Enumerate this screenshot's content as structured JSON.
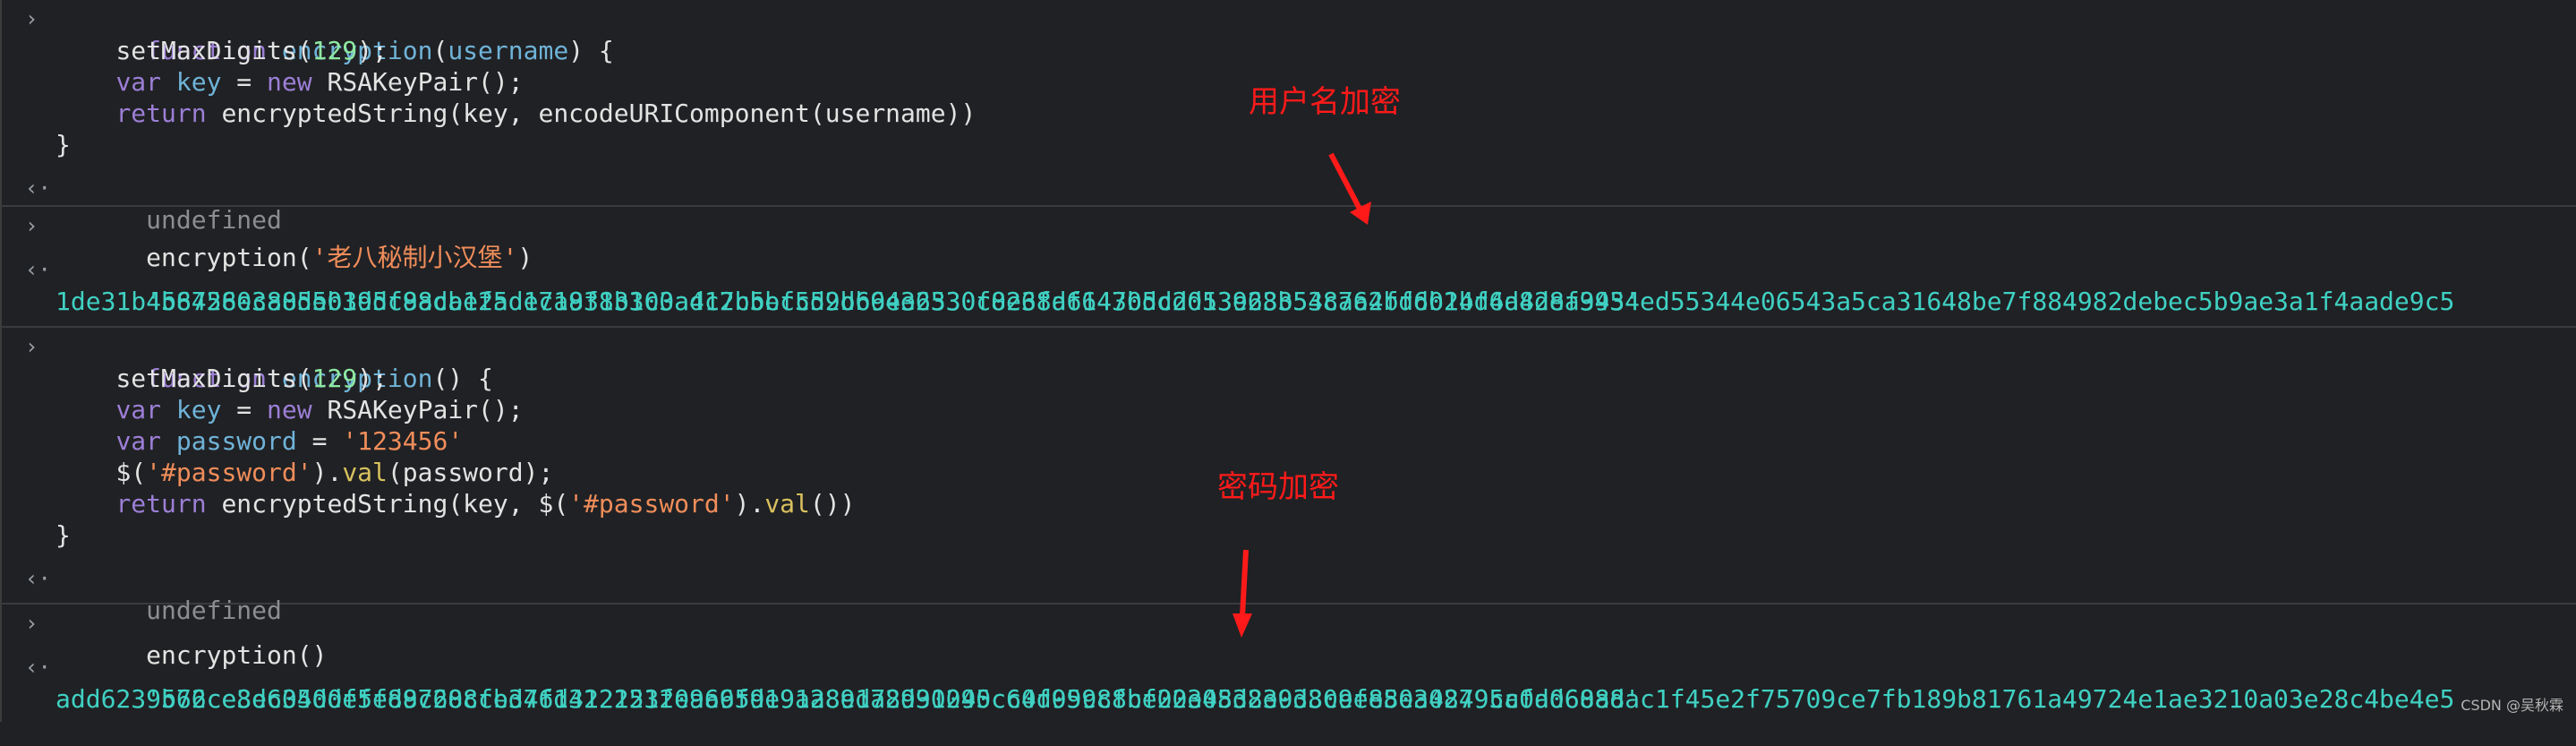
{
  "console": {
    "entries": [
      {
        "type": "input",
        "lines": [
          [
            "function",
            " ",
            "encryption",
            "(",
            "username",
            ") {"
          ],
          [
            "setMaxDigits(",
            "129",
            ");"
          ],
          [
            "var",
            " ",
            "key",
            " = ",
            "new",
            " RSAKeyPair();"
          ],
          [
            "return",
            " encryptedString(key, encodeURIComponent(username))"
          ],
          [
            "}"
          ]
        ],
        "result": "undefined"
      },
      {
        "type": "input",
        "call_prefix": "encryption(",
        "call_arg": "'老八秘制小汉堡'",
        "call_suffix": ")",
        "result_lines": [
          "'56726ec885eb1ddf98da125d1c18313100adc2bbbf5d2bb9ee6530c826fa6147bdc2d13e683548a62ff6014f6d828a9954ed55344e06543a5ca31648be7f884982debec5b9ae3a1f4aade9c5",
          "1de31b4b845803a0d50395c8acbefade7a9f8b3c3a417c5ecc59d66432330f0e38df64305dd053923b53c7a4bddb2bd4a4def343'"
        ]
      },
      {
        "type": "input",
        "lines": [
          [
            "function",
            " ",
            "encryption",
            "() {"
          ],
          [
            "setMaxDigits(",
            "129",
            ");"
          ],
          [
            "var",
            " ",
            "key",
            " = ",
            "new",
            " RSAKeyPair();"
          ],
          [
            "var",
            " ",
            "password",
            " = ",
            "'123456'"
          ],
          [
            "$(",
            "'#password'",
            ").",
            "val",
            "(password);"
          ],
          [
            "return",
            " encryptedString(key, $(",
            "'#password'",
            ").",
            "val",
            "())"
          ],
          [
            "}"
          ]
        ],
        "result": "undefined"
      },
      {
        "type": "input",
        "call": "encryption()",
        "result_lines": [
          "'562ce3d604d0f5f887608fed4f14121532eaa65de9a28e172930245cc4f999cfbf22e08d83938c9ee8e30849cc0dd60adac1f45e2f75709ce7fb189b81761a49724e1ae3210a03e28c4be4e5",
          "add6239b76ce8ec350defed9c28ccb376d322221f0969f9191a89da8d91090c60d05c88ce0034532e0d30ef850a42795afa06888'"
        ]
      }
    ],
    "prompt_input": "›",
    "prompt_output": "‹·"
  },
  "annotations": {
    "username_label": "用户名加密",
    "password_label": "密码加密",
    "color": "#ff1a1a"
  },
  "watermark": "CSDN @吴秋霖"
}
